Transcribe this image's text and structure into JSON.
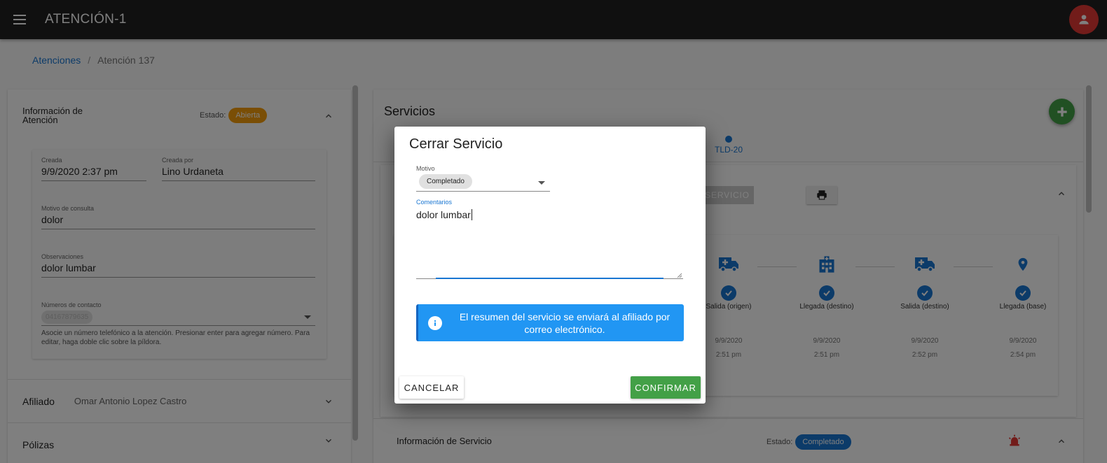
{
  "app": {
    "title": "ATENCIÓN-1"
  },
  "breadcrumb": {
    "root": "Atenciones",
    "separator": "/",
    "current": "Atención 137"
  },
  "attention_info": {
    "title": "Información de Atención",
    "estado_label": "Estado:",
    "estado_value": "Abierta",
    "created_label": "Creada",
    "created_value": "9/9/2020 2:37 pm",
    "created_by_label": "Creada por",
    "created_by_value": "Lino Urdaneta",
    "reason_label": "Motivo de consulta",
    "reason_value": "dolor",
    "observations_label": "Observaciones",
    "observations_value": "dolor lumbar",
    "contacts_label": "Números de contacto",
    "contact_chip": "04167879635",
    "contacts_hint": "Asocie un número telefónico a la atención. Presionar enter para agregar número. Para editar, haga doble clic sobre la píldora."
  },
  "affiliate": {
    "label": "Afiliado",
    "value": "Omar Antonio Lopez Castro"
  },
  "policies": {
    "label": "Pólizas"
  },
  "services": {
    "title": "Servicios",
    "tab_label": "TLD-20",
    "service_button": "SERVICIO",
    "timeline": [
      {
        "icon": "ambulance-icon",
        "label": "Salida (origen)",
        "date": "9/9/2020",
        "time": "2:51 pm"
      },
      {
        "icon": "hospital-icon",
        "label": "Llegada (destino)",
        "date": "9/9/2020",
        "time": "2:51 pm"
      },
      {
        "icon": "ambulance-icon",
        "label": "Salida (destino)",
        "date": "9/9/2020",
        "time": "2:52 pm"
      },
      {
        "icon": "location-pin-icon",
        "label": "Llegada (base)",
        "date": "9/9/2020",
        "time": "2:54 pm"
      }
    ],
    "info_title": "Información de Servicio",
    "info_estado_label": "Estado:",
    "info_estado_value": "Completado"
  },
  "dialog": {
    "title": "Cerrar Servicio",
    "reason_label": "Motivo",
    "reason_value": "Completado",
    "comments_label": "Comentarios",
    "comments_value": "dolor lumbar",
    "alert_text": "El resumen del servicio se enviará al afiliado por correo electrónico.",
    "cancel_label": "CANCELAR",
    "confirm_label": "CONFIRMAR"
  },
  "colors": {
    "primary": "#1976d2",
    "success": "#43a047",
    "warning": "#f59d0b",
    "danger": "#e53935",
    "info": "#2196f3"
  }
}
